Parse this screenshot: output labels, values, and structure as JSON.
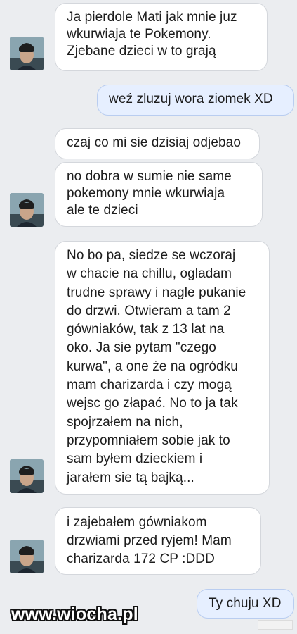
{
  "messages": [
    {
      "id": "m1",
      "direction": "incoming",
      "text": "Ja pierdole Mati jak mnie juz\nwkurwiaja te Pokemony.\nZjebane dzieci w to grają"
    },
    {
      "id": "m2",
      "direction": "outgoing",
      "text": "weź zluzuj wora ziomek XD"
    },
    {
      "id": "m3",
      "direction": "incoming",
      "text": "czaj co mi sie dzisiaj odjebao"
    },
    {
      "id": "m4",
      "direction": "incoming",
      "text": "no dobra w sumie nie same\npokemony mnie wkurwiaja\nale te dzieci"
    },
    {
      "id": "m5",
      "direction": "incoming",
      "text": "No bo pa, siedze se wczoraj\nw chacie na chillu, ogladam\ntrudne sprawy i nagle pukanie\ndo drzwi. Otwieram a tam 2\ngówniaków, tak z 13 lat na\noko. Ja sie pytam \"czego\nkurwa\", a one że na ogródku\nmam charizarda i czy mogą\nwejsc go złapać. No to ja tak\nspojrzałem na nich,\nprzypomniałem sobie jak to\nsam byłem dzieckiem i\njarałem sie tą bajką..."
    },
    {
      "id": "m6",
      "direction": "incoming",
      "text": "i zajebałem gówniakom\ndrzwiami przed ryjem! Mam\ncharizarda 172 CP :DDD"
    },
    {
      "id": "m7",
      "direction": "outgoing",
      "text": "Ty chuju XD"
    }
  ],
  "watermark": "www.wiocha.pl",
  "colors": {
    "background": "#ebedf0",
    "incoming_bubble": "#ffffff",
    "outgoing_bubble": "#e6efff"
  }
}
